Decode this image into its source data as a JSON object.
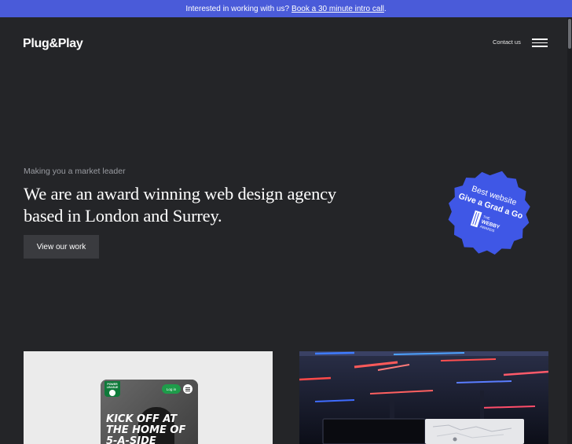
{
  "announcement": {
    "text": "Interested in working with us?",
    "link": "Book a 30 minute intro call",
    "suffix": "."
  },
  "header": {
    "logo": "Plug&Play",
    "contact_label": "Contact us"
  },
  "hero": {
    "eyebrow": "Making you a market leader",
    "headline": "We are an award winning web design agency based in London and Surrey.",
    "cta_label": "View our work"
  },
  "badge": {
    "line1": "Best website",
    "line2": "Give a Grad a Go",
    "award_line1": "THE",
    "award_line2": "WEBBY",
    "award_line3": "AWARDS",
    "color": "#3f57e6"
  },
  "work": {
    "card1": {
      "logo_text": "POWER LEAGUE",
      "login_label": "Log in",
      "title": "KICK OFF AT\nTHE HOME OF\n5-A-SIDE"
    }
  },
  "colors": {
    "background": "#242528",
    "banner": "#4a5bd9",
    "button": "#3a3b3f"
  }
}
